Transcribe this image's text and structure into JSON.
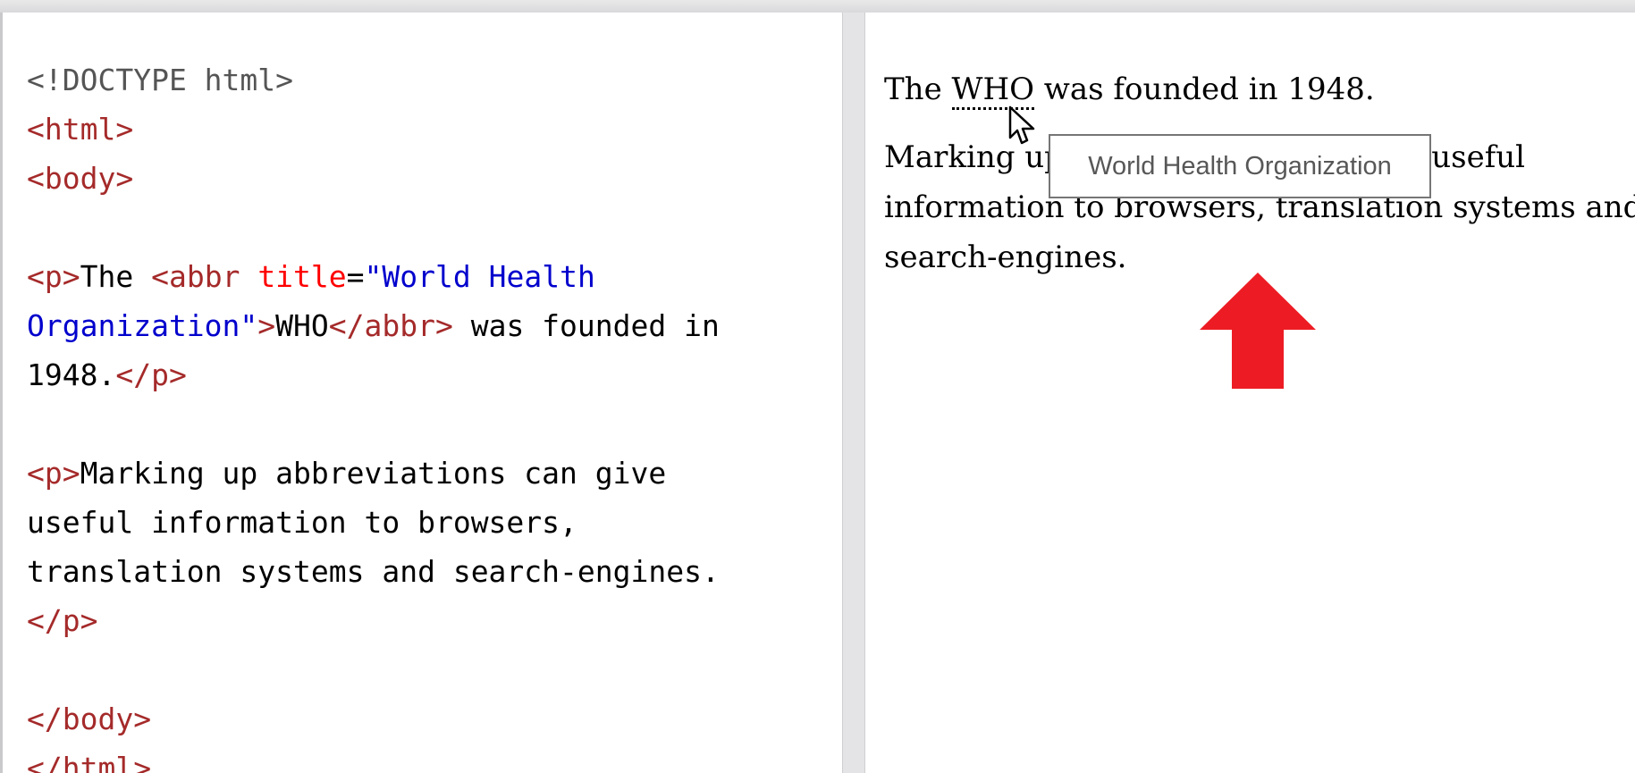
{
  "code_editor": {
    "lines": {
      "doctype": "<!DOCTYPE html>",
      "html_open": "<html>",
      "body_open": "<body>",
      "p1_open": "<p>",
      "p1_text_the": "The ",
      "abbr_open_start": "<abbr",
      "attr_title": "title",
      "attr_equals": "=",
      "attr_value_part1": "\"World Health",
      "attr_value_part2": "Organization\"",
      "abbr_open_end": ">",
      "abbr_text": "WHO",
      "abbr_close": "</abbr>",
      "p1_text_rest1": " was founded in",
      "p1_text_rest2": "1948.",
      "p1_close": "</p>",
      "p2_open": "<p>",
      "p2_line1": "Marking up abbreviations can give",
      "p2_line2": "useful information to browsers,",
      "p2_line3": "translation systems and search-engines.",
      "p2_close": "</p>",
      "body_close": "</body>",
      "html_close": "</html>"
    },
    "colors": {
      "tag": "#a52a2a",
      "bracket": "#0000cd",
      "attribute": "#ff0000",
      "value": "#0000cd"
    }
  },
  "preview": {
    "p1_before": "The ",
    "abbr_text": "WHO",
    "p1_after": " was founded in 1948.",
    "p2_text": "Marking up abbreviations can give useful information to browsers, translation systems and search-engines.",
    "tooltip": "World Health Organization"
  },
  "icons": {
    "cursor": "mouse-pointer-icon",
    "arrow": "red-up-arrow-icon",
    "arrow_color": "#ed1c24"
  }
}
